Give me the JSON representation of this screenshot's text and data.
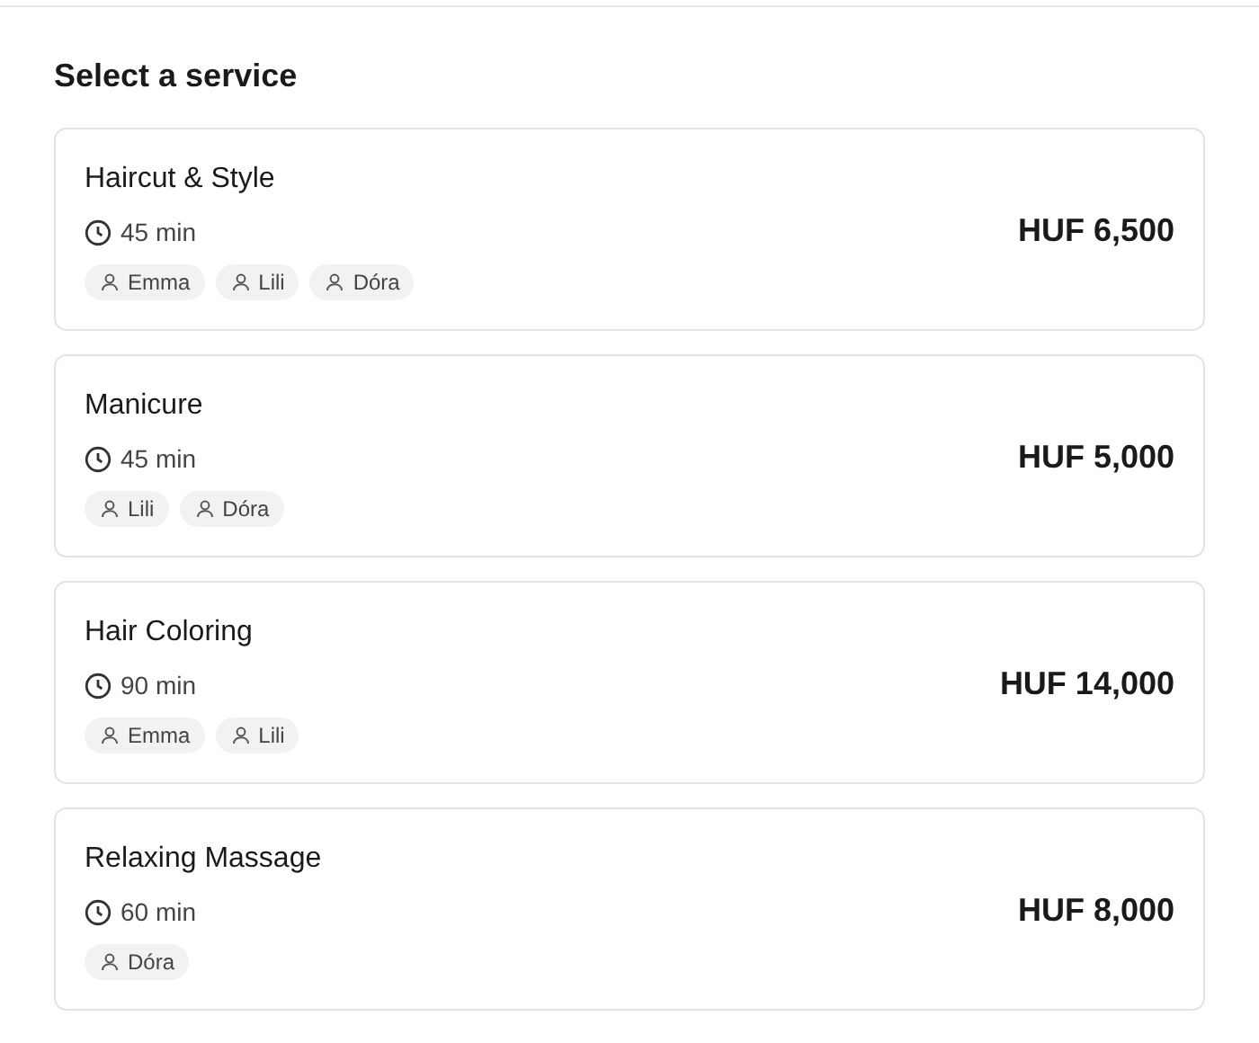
{
  "heading": "Select a service",
  "services": [
    {
      "name": "Haircut & Style",
      "duration": "45 min",
      "price": "HUF 6,500",
      "staff": [
        "Emma",
        "Lili",
        "Dóra"
      ]
    },
    {
      "name": "Manicure",
      "duration": "45 min",
      "price": "HUF 5,000",
      "staff": [
        "Lili",
        "Dóra"
      ]
    },
    {
      "name": "Hair Coloring",
      "duration": "90 min",
      "price": "HUF 14,000",
      "staff": [
        "Emma",
        "Lili"
      ]
    },
    {
      "name": "Relaxing Massage",
      "duration": "60 min",
      "price": "HUF 8,000",
      "staff": [
        "Dóra"
      ]
    }
  ]
}
